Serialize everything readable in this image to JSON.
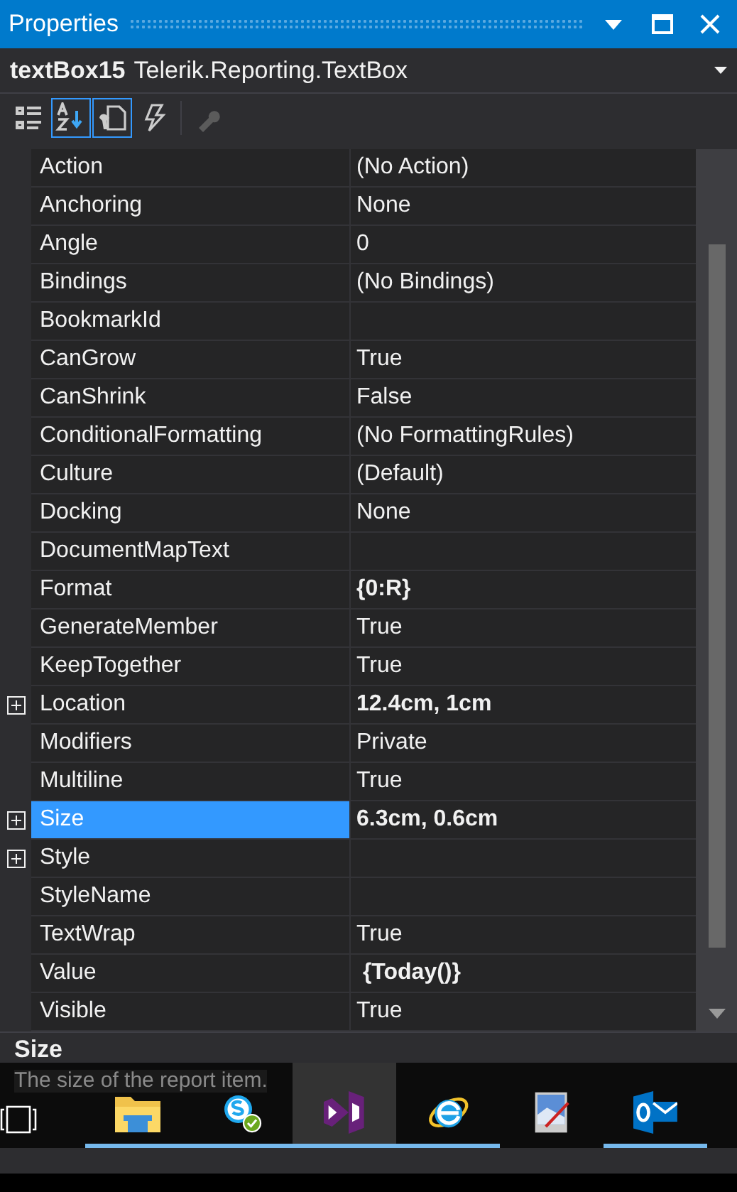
{
  "window": {
    "title": "Properties"
  },
  "object_selector": {
    "name": "textBox15",
    "type": "Telerik.Reporting.TextBox"
  },
  "toolbar": [
    {
      "kind": "categorized",
      "selected": false,
      "disabled": false
    },
    {
      "kind": "alphabetical",
      "selected": true,
      "disabled": false
    },
    {
      "kind": "properties",
      "selected": true,
      "disabled": false
    },
    {
      "kind": "events",
      "selected": false,
      "disabled": false
    },
    {
      "kind": "property-pages",
      "selected": false,
      "disabled": true
    }
  ],
  "properties": [
    {
      "name": "Action",
      "value": "(No Action)",
      "bold": false,
      "expandable": false,
      "selected": false
    },
    {
      "name": "Anchoring",
      "value": "None",
      "bold": false,
      "expandable": false,
      "selected": false
    },
    {
      "name": "Angle",
      "value": "0",
      "bold": false,
      "expandable": false,
      "selected": false
    },
    {
      "name": "Bindings",
      "value": "(No Bindings)",
      "bold": false,
      "expandable": false,
      "selected": false
    },
    {
      "name": "BookmarkId",
      "expandable": false,
      "selected": false
    },
    {
      "name": "CanGrow",
      "value": "True",
      "bold": false,
      "expandable": false,
      "selected": false
    },
    {
      "name": "CanShrink",
      "value": "False",
      "bold": false,
      "expandable": false,
      "selected": false
    },
    {
      "name": "ConditionalFormatting",
      "value": "(No FormattingRules)",
      "bold": false,
      "expandable": false,
      "selected": false
    },
    {
      "name": "Culture",
      "value": "(Default)",
      "bold": false,
      "expandable": false,
      "selected": false
    },
    {
      "name": "Docking",
      "value": "None",
      "bold": false,
      "expandable": false,
      "selected": false
    },
    {
      "name": "DocumentMapText",
      "expandable": false,
      "selected": false
    },
    {
      "name": "Format",
      "value": "{0:R}",
      "bold": true,
      "expandable": false,
      "selected": false
    },
    {
      "name": "GenerateMember",
      "value": "True",
      "bold": false,
      "expandable": false,
      "selected": false
    },
    {
      "name": "KeepTogether",
      "value": "True",
      "bold": false,
      "expandable": false,
      "selected": false
    },
    {
      "name": "Location",
      "value": "12.4cm, 1cm",
      "bold": true,
      "expandable": true,
      "selected": false
    },
    {
      "name": "Modifiers",
      "value": "Private",
      "bold": false,
      "expandable": false,
      "selected": false
    },
    {
      "name": "Multiline",
      "value": "True",
      "bold": false,
      "expandable": false,
      "selected": false
    },
    {
      "name": "Size",
      "value": "6.3cm, 0.6cm",
      "bold": true,
      "expandable": true,
      "selected": true
    },
    {
      "name": "Style",
      "expandable": true,
      "selected": false
    },
    {
      "name": "StyleName",
      "expandable": false,
      "selected": false
    },
    {
      "name": "TextWrap",
      "value": "True",
      "bold": false,
      "expandable": false,
      "selected": false
    },
    {
      "name": "Value",
      "value": " {Today()}",
      "bold": true,
      "expandable": false,
      "selected": false
    },
    {
      "name": "Visible",
      "value": "True",
      "bold": false,
      "expandable": false,
      "selected": false
    }
  ],
  "description": {
    "title": "Size",
    "text": "The size of the report item."
  },
  "taskbar": [
    {
      "kind": "task-view",
      "selected": false,
      "running": false
    },
    {
      "kind": "folder",
      "selected": false,
      "running": true
    },
    {
      "kind": "chat",
      "selected": false,
      "running": true
    },
    {
      "kind": "studio",
      "selected": true,
      "running": true
    },
    {
      "kind": "browser",
      "selected": false,
      "running": true
    },
    {
      "kind": "paint",
      "selected": false,
      "running": false
    },
    {
      "kind": "mail",
      "selected": false,
      "running": true
    }
  ]
}
